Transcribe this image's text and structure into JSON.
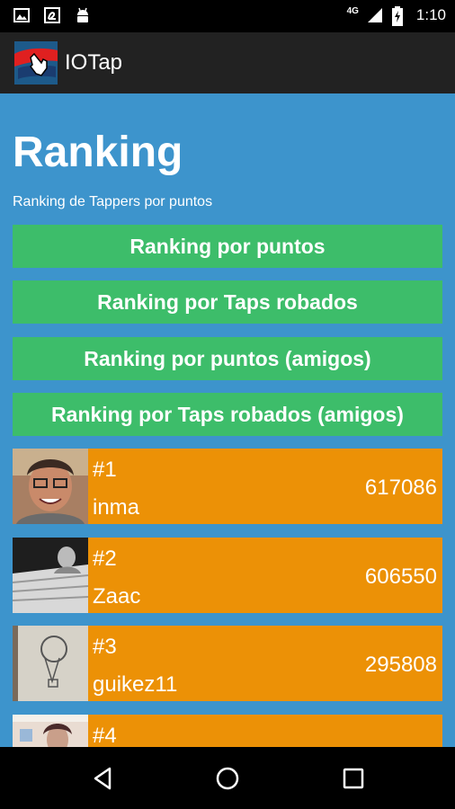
{
  "status_bar": {
    "network": "4G",
    "time": "1:10",
    "icons": [
      "image-icon",
      "font-icon",
      "android-icon",
      "signal-icon",
      "battery-charging-icon"
    ]
  },
  "action_bar": {
    "app_title": "IOTap",
    "app_icon": "iotap-logo-icon"
  },
  "main": {
    "title": "Ranking",
    "subtitle": "Ranking de Tappers por puntos",
    "buttons": [
      {
        "label": "Ranking por puntos"
      },
      {
        "label": "Ranking por Taps robados"
      },
      {
        "label": "Ranking por puntos (amigos)"
      },
      {
        "label": "Ranking por Taps robados (amigos)"
      }
    ],
    "ranking": [
      {
        "rank": "#1",
        "name": "inma",
        "score": "617086"
      },
      {
        "rank": "#2",
        "name": "Zaac",
        "score": "606550"
      },
      {
        "rank": "#3",
        "name": "guikez11",
        "score": "295808"
      },
      {
        "rank": "#4",
        "name": "",
        "score": ""
      }
    ]
  },
  "nav_bar": {
    "buttons": [
      "back-icon",
      "home-icon",
      "recents-icon"
    ]
  },
  "colors": {
    "background": "#3d94cc",
    "button": "#3dbd6a",
    "row": "#ec9106",
    "action_bar": "#222222"
  }
}
